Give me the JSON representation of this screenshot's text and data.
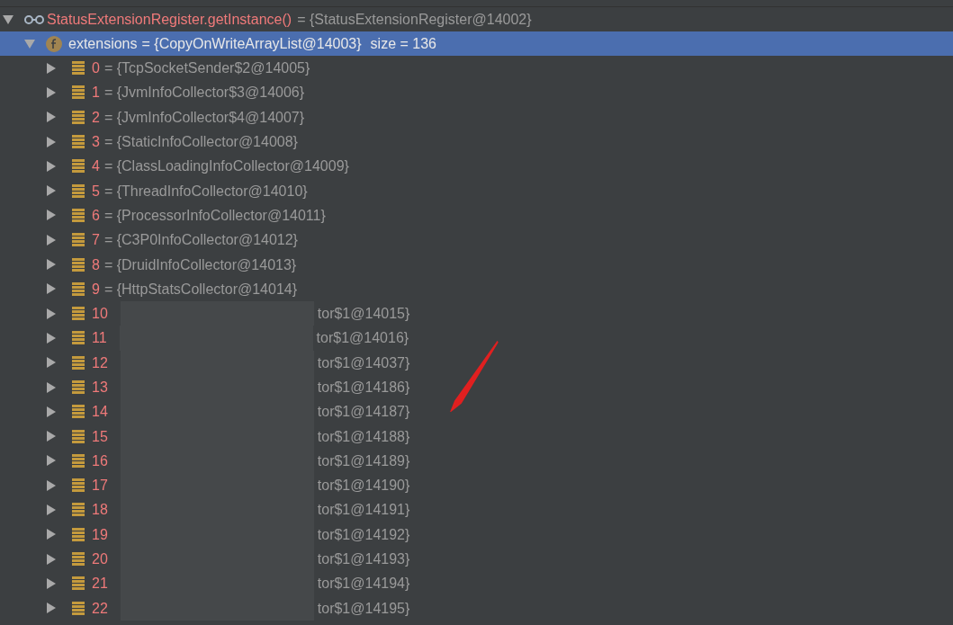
{
  "root": {
    "name": "StatusExtensionRegister.getInstance()",
    "value": "= {StatusExtensionRegister@14002}",
    "expanded": true
  },
  "field": {
    "name": "extensions",
    "value": "= {CopyOnWriteArrayList@14003}",
    "size": "size = 136",
    "expanded": true,
    "selected": true
  },
  "items": [
    {
      "index": "0",
      "value": "= {TcpSocketSender$2@14005}",
      "redacted": false
    },
    {
      "index": "1",
      "value": "= {JvmInfoCollector$3@14006}",
      "redacted": false
    },
    {
      "index": "2",
      "value": "= {JvmInfoCollector$4@14007}",
      "redacted": false
    },
    {
      "index": "3",
      "value": "= {StaticInfoCollector@14008}",
      "redacted": false
    },
    {
      "index": "4",
      "value": "= {ClassLoadingInfoCollector@14009}",
      "redacted": false
    },
    {
      "index": "5",
      "value": "= {ThreadInfoCollector@14010}",
      "redacted": false
    },
    {
      "index": "6",
      "value": "= {ProcessorInfoCollector@14011}",
      "redacted": false
    },
    {
      "index": "7",
      "value": "= {C3P0InfoCollector@14012}",
      "redacted": false
    },
    {
      "index": "8",
      "value": "= {DruidInfoCollector@14013}",
      "redacted": false
    },
    {
      "index": "9",
      "value": "= {HttpStatsCollector@14014}",
      "redacted": false
    },
    {
      "index": "10",
      "value": "tor$1@14015}",
      "redacted": true
    },
    {
      "index": "11",
      "value": "tor$1@14016}",
      "redacted": true
    },
    {
      "index": "12",
      "value": "tor$1@14037}",
      "redacted": true
    },
    {
      "index": "13",
      "value": "tor$1@14186}",
      "redacted": true
    },
    {
      "index": "14",
      "value": "tor$1@14187}",
      "redacted": true
    },
    {
      "index": "15",
      "value": "tor$1@14188}",
      "redacted": true
    },
    {
      "index": "16",
      "value": "tor$1@14189}",
      "redacted": true
    },
    {
      "index": "17",
      "value": "tor$1@14190}",
      "redacted": true
    },
    {
      "index": "18",
      "value": "tor$1@14191}",
      "redacted": true
    },
    {
      "index": "19",
      "value": "tor$1@14192}",
      "redacted": true
    },
    {
      "index": "20",
      "value": "tor$1@14193}",
      "redacted": true
    },
    {
      "index": "21",
      "value": "tor$1@14194}",
      "redacted": true
    },
    {
      "index": "22",
      "value": "tor$1@14195}",
      "redacted": true
    }
  ]
}
